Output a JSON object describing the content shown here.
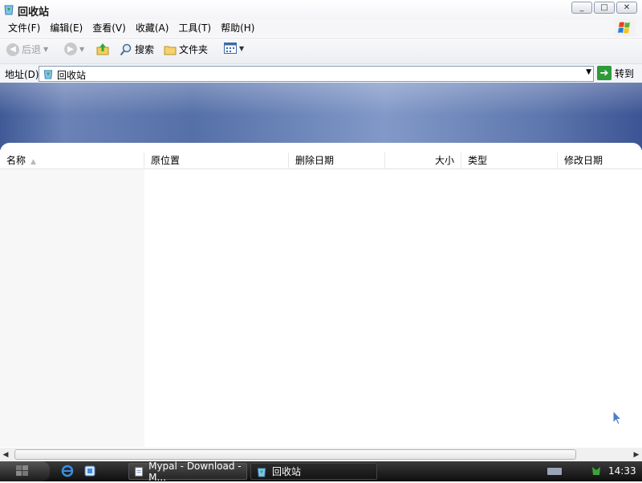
{
  "window": {
    "title": "回收站",
    "icon": "recycle-bin-icon",
    "controls": [
      "minimize",
      "maximize",
      "close"
    ]
  },
  "menu": [
    {
      "label": "文件(F)"
    },
    {
      "label": "编辑(E)"
    },
    {
      "label": "查看(V)"
    },
    {
      "label": "收藏(A)"
    },
    {
      "label": "工具(T)"
    },
    {
      "label": "帮助(H)"
    }
  ],
  "toolbar": {
    "back_label": "后退",
    "forward_icon": "forward-icon",
    "up_icon": "up-folder-icon",
    "search_label": "搜索",
    "folders_label": "文件夹",
    "views_icon": "views-icon"
  },
  "address": {
    "label": "地址(D)",
    "value": "回收站",
    "go_label": "转到"
  },
  "columns": [
    "名称",
    "原位置",
    "删除日期",
    "大小",
    "类型",
    "修改日期"
  ],
  "taskbar": {
    "tasks": [
      "Mypal - Download - M...",
      "回收站"
    ],
    "clock": "14:33"
  },
  "colors": {
    "banner": "#5570a8",
    "address_border": "#7f9db9",
    "go_green": "#2e9a3a",
    "taskbar": "#1a1a1a"
  }
}
